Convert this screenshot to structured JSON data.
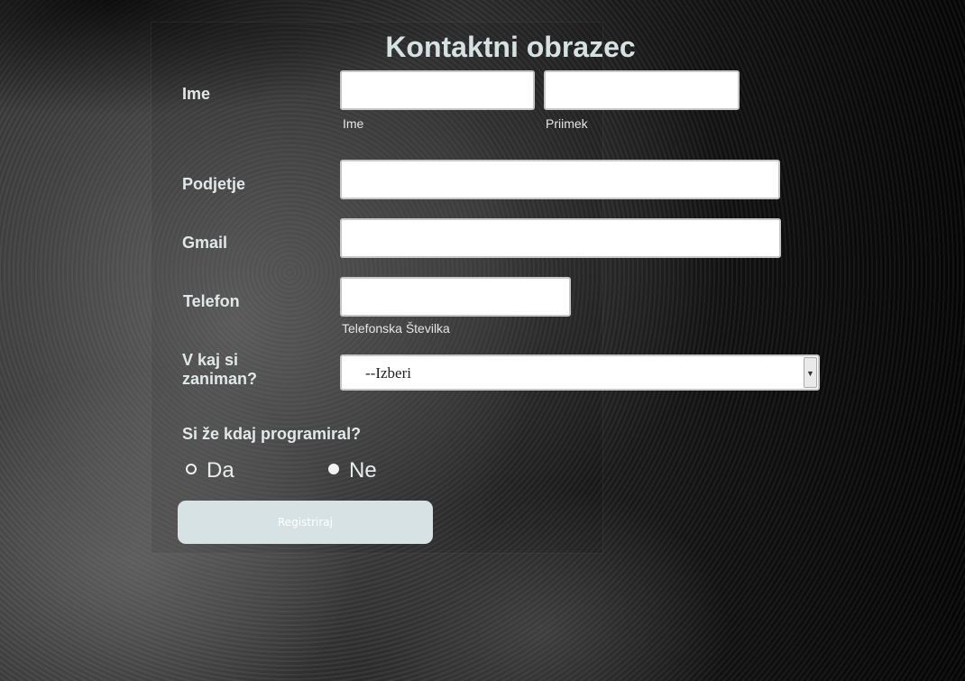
{
  "form": {
    "title": "Kontaktni obrazec",
    "name": {
      "label": "Ime",
      "first_hint": "Ime",
      "last_hint": "Priimek",
      "first_value": "",
      "last_value": ""
    },
    "company": {
      "label": "Podjetje",
      "value": ""
    },
    "email": {
      "label": "Gmail",
      "value": ""
    },
    "phone": {
      "label": "Telefon",
      "hint": "Telefonska Številka",
      "value": ""
    },
    "interest": {
      "label_line1": "V kaj si",
      "label_line2": "zaniman?",
      "selected": "--Izberi"
    },
    "programmed": {
      "question": "Si že kdaj programiral?",
      "options": [
        {
          "label": "Da",
          "checked": false
        },
        {
          "label": "Ne",
          "checked": true
        }
      ]
    },
    "submit_label": "Registriraj"
  },
  "colors": {
    "title": "#d6e1e2",
    "button_bg": "#d6e2e3",
    "label": "#e2e8e8"
  }
}
